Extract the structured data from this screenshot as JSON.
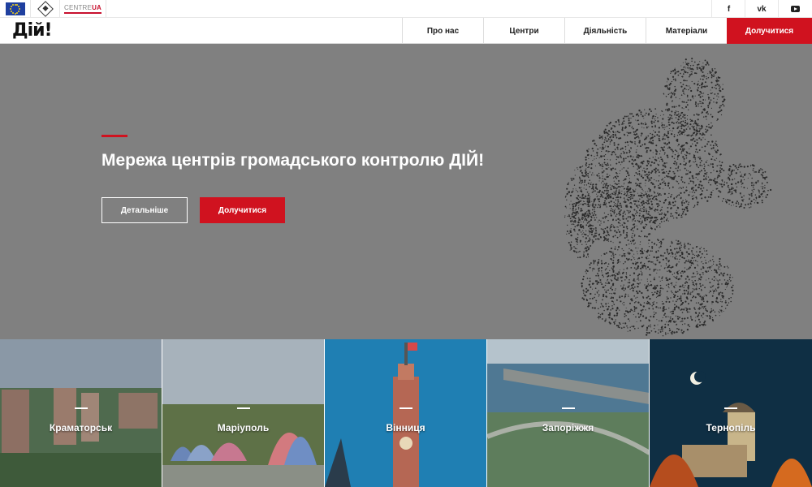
{
  "partners": {
    "centre_ua_prefix": "CENTRE",
    "centre_ua_suffix": "UA"
  },
  "social": {
    "facebook": "f",
    "vk": "vk"
  },
  "nav": {
    "logo": "Дій!",
    "items": [
      {
        "label": "Про нас"
      },
      {
        "label": "Центри"
      },
      {
        "label": "Діяльність"
      },
      {
        "label": "Матеріали"
      }
    ],
    "join_label": "Долучитися"
  },
  "hero": {
    "title": "Мережа центрів громадського контролю ДІЙ!",
    "more_label": "Детальніше",
    "join_label": "Долучитися"
  },
  "cities": [
    {
      "name": "Краматорськ"
    },
    {
      "name": "Маріуполь"
    },
    {
      "name": "Вінниця"
    },
    {
      "name": "Запоріжжя"
    },
    {
      "name": "Тернопіль"
    }
  ],
  "colors": {
    "accent": "#d0121f",
    "hero_bg": "#808080"
  }
}
